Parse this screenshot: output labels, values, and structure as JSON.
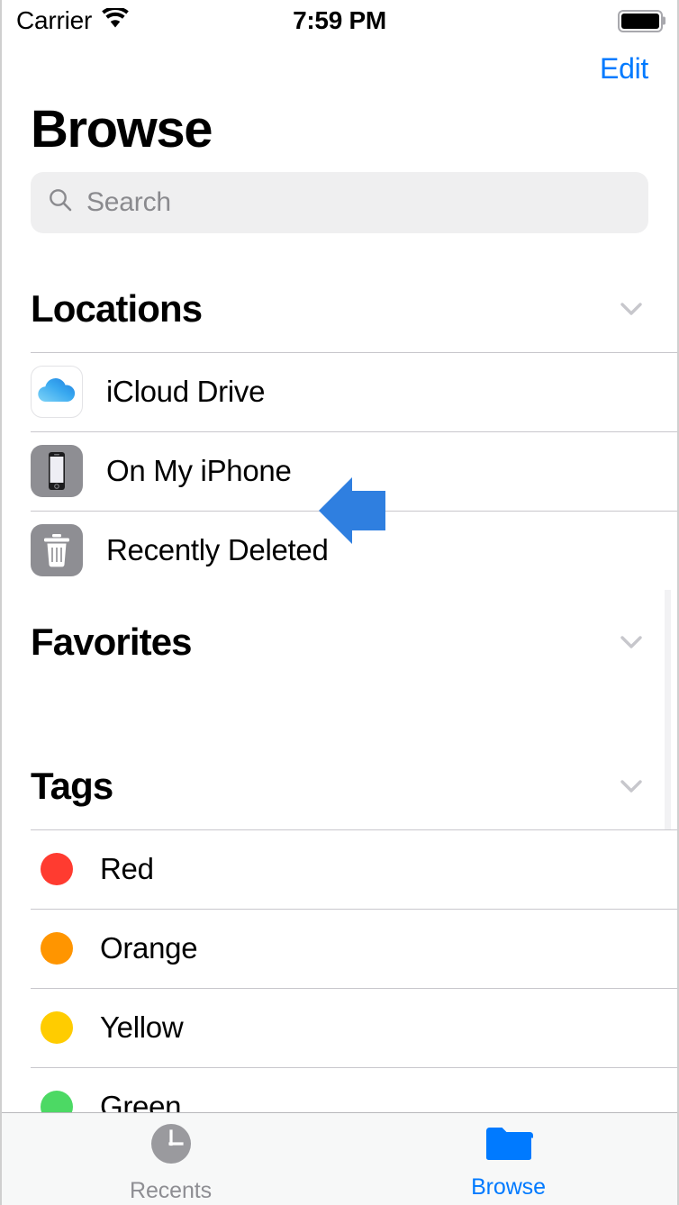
{
  "status_bar": {
    "carrier": "Carrier",
    "wifi_icon": "wifi-icon",
    "time": "7:59 PM",
    "battery_icon": "battery-full-icon"
  },
  "nav": {
    "edit_label": "Edit"
  },
  "header": {
    "title": "Browse"
  },
  "search": {
    "placeholder": "Search",
    "value": "",
    "icon": "search-icon"
  },
  "sections": [
    {
      "title": "Locations",
      "chevron_icon": "chevron-down-icon",
      "items": [
        {
          "label": "iCloud Drive",
          "icon": "icloud-drive-icon"
        },
        {
          "label": "On My iPhone",
          "icon": "iphone-icon"
        },
        {
          "label": "Recently Deleted",
          "icon": "trash-icon"
        }
      ]
    },
    {
      "title": "Favorites",
      "chevron_icon": "chevron-down-icon",
      "items": []
    },
    {
      "title": "Tags",
      "chevron_icon": "chevron-down-icon",
      "items": [
        {
          "label": "Red",
          "color": "#ff3b30"
        },
        {
          "label": "Orange",
          "color": "#ff9500"
        },
        {
          "label": "Yellow",
          "color": "#ffcc00"
        },
        {
          "label": "Green",
          "color": "#4cd964"
        }
      ]
    }
  ],
  "annotation": {
    "type": "left-pointing-arrow",
    "color": "#2f7fe0",
    "points_at": "On My iPhone"
  },
  "tab_bar": {
    "items": [
      {
        "label": "Recents",
        "icon": "clock-icon",
        "active": false
      },
      {
        "label": "Browse",
        "icon": "folder-icon",
        "active": true
      }
    ]
  },
  "colors": {
    "accent": "#007aff",
    "separator": "#c8c7cc",
    "search_background": "#efeff0",
    "icon_gray": "#8e8e93",
    "tab_bar_background": "#f7f8f8"
  }
}
